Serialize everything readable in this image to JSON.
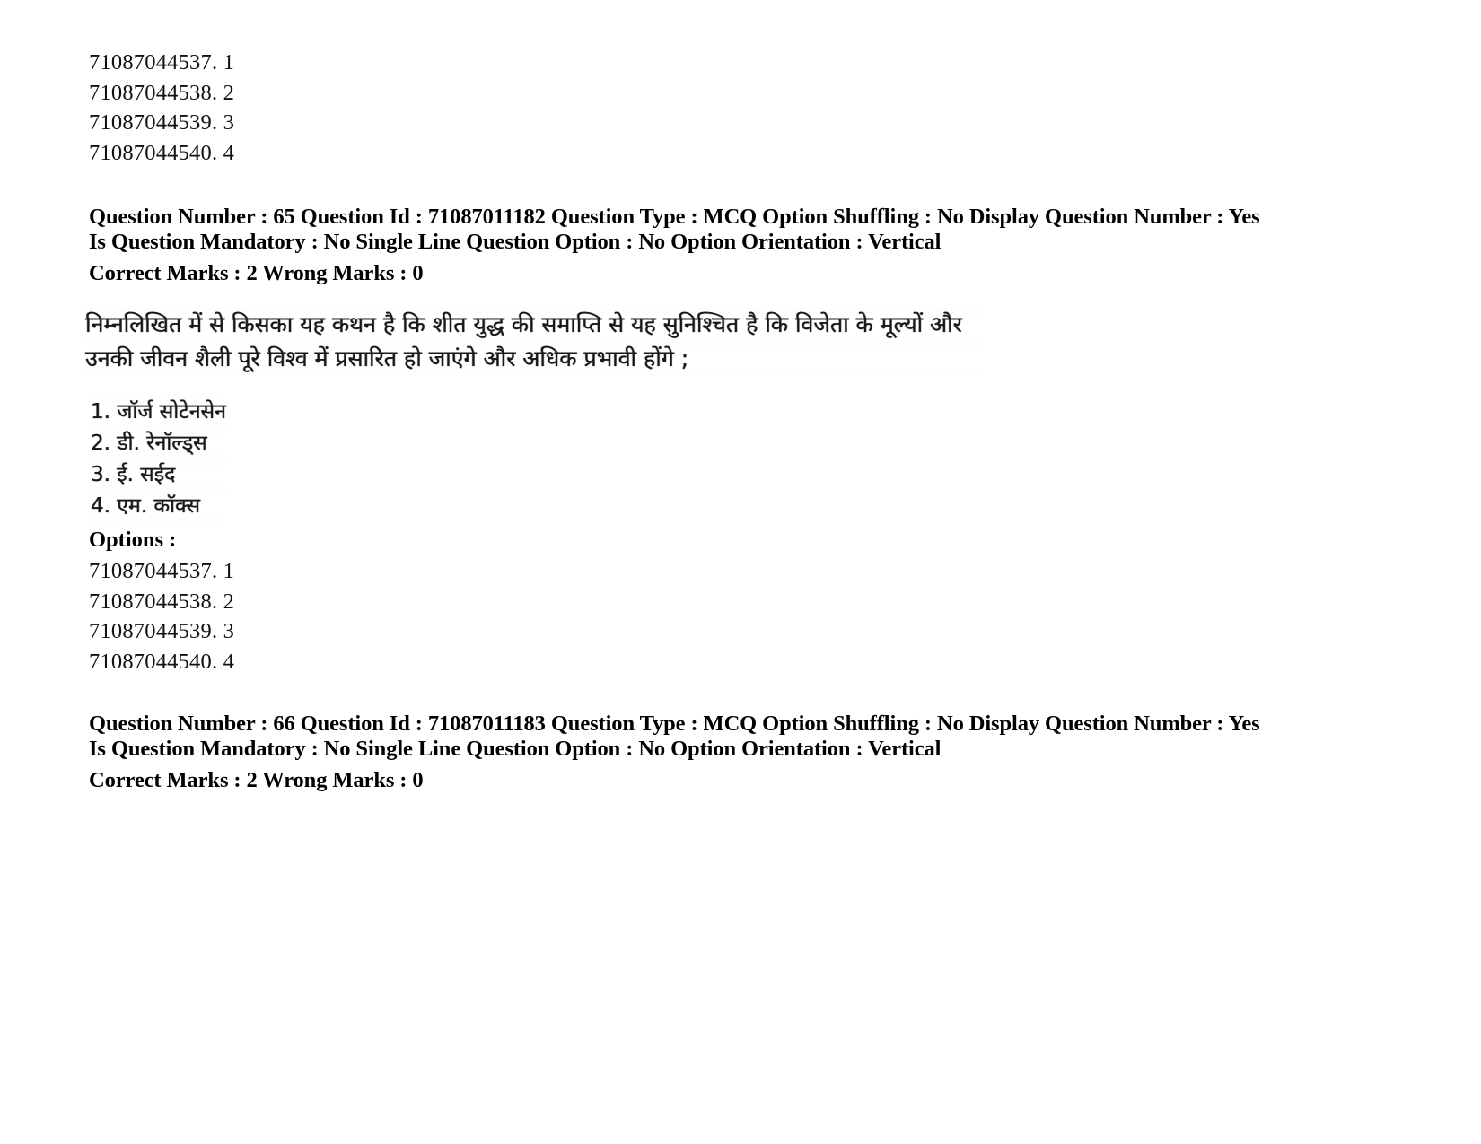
{
  "document": {
    "type": "exam-question-paper-page",
    "language_primary": "Hindi",
    "language_meta": "English"
  },
  "top_option_ids": {
    "rows": [
      "71087044537. 1",
      "71087044538. 2",
      "71087044539. 3",
      "71087044540. 4"
    ]
  },
  "question_65": {
    "meta_line_1": "Question Number : 65 Question Id : 71087011182 Question Type : MCQ Option Shuffling : No Display Question Number : Yes Is Question Mandatory : No Single Line Question Option : No Option Orientation : Vertical",
    "marks_line": "Correct Marks : 2 Wrong Marks : 0",
    "question_number": "65",
    "question_id": "71087011182",
    "question_type": "MCQ",
    "option_shuffling": "No",
    "display_question_number": "Yes",
    "is_question_mandatory": "No",
    "single_line_question_option": "No",
    "option_orientation": "Vertical",
    "correct_marks": "2",
    "wrong_marks": "0",
    "body_line_1": "निम्नलिखित में से किसका यह कथन है कि शीत युद्ध की समाप्ति से यह सुनिश्चित है कि विजेता के मूल्यों और",
    "body_line_2": "उनकी जीवन शैली पूरे विश्व में प्रसारित हो जाएंगे और अधिक प्रभावी होंगे ;",
    "choices": [
      "1. जॉर्ज सोटेनसेन",
      "2. डी. रेनॉल्ड्स",
      "3. ई. सईद",
      "4. एम. कॉक्स"
    ],
    "options_label": "Options :",
    "option_ids": [
      "71087044537. 1",
      "71087044538. 2",
      "71087044539. 3",
      "71087044540. 4"
    ]
  },
  "question_66": {
    "meta_line_1": "Question Number : 66 Question Id : 71087011183 Question Type : MCQ Option Shuffling : No Display Question Number : Yes Is Question Mandatory : No Single Line Question Option : No Option Orientation : Vertical",
    "marks_line": "Correct Marks : 2 Wrong Marks : 0",
    "question_number": "66",
    "question_id": "71087011183",
    "question_type": "MCQ",
    "option_shuffling": "No",
    "display_question_number": "Yes",
    "is_question_mandatory": "No",
    "single_line_question_option": "No",
    "option_orientation": "Vertical",
    "correct_marks": "2",
    "wrong_marks": "0"
  }
}
